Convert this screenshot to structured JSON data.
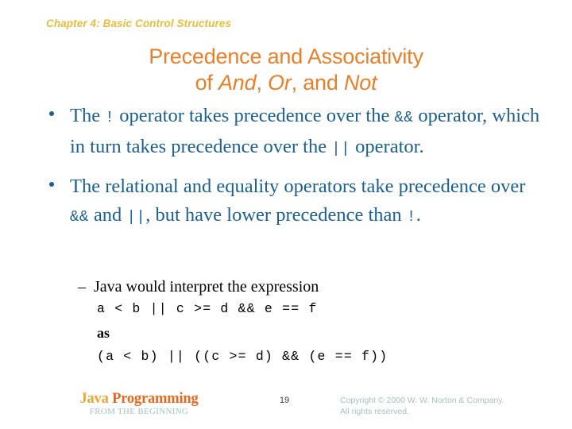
{
  "slide": {
    "background_color": "#ffffff",
    "chapter_header": "Chapter 4: Basic Control Structures",
    "chapter_header_color": "#e8bc3c",
    "title": {
      "color": "#e8802a",
      "line1": "Precedence and Associativity",
      "line2_prefix": "of ",
      "line2_em1": "And",
      "line2_mid1": ", ",
      "line2_em2": "Or",
      "line2_mid2": ", and ",
      "line2_em3": "Not"
    },
    "body_color": "#1c6090",
    "bullets": [
      {
        "marker": "bullet-dot",
        "segments": [
          {
            "kind": "text",
            "value": "The "
          },
          {
            "kind": "code",
            "value": "!"
          },
          {
            "kind": "text",
            "value": " operator takes precedence over the "
          },
          {
            "kind": "code",
            "value": "&&"
          },
          {
            "kind": "text",
            "value": " operator, which in turn takes precedence over the "
          },
          {
            "kind": "code",
            "value": "||"
          },
          {
            "kind": "text",
            "value": " operator."
          }
        ],
        "plain": "The ! operator takes precedence over the && operator, which in turn takes precedence over the || operator."
      },
      {
        "marker": "bullet-dot",
        "segments": [
          {
            "kind": "text",
            "value": "The relational and equality operators take precedence over "
          },
          {
            "kind": "code",
            "value": "&&"
          },
          {
            "kind": "text",
            "value": " and "
          },
          {
            "kind": "code",
            "value": "||"
          },
          {
            "kind": "text",
            "value": ", but have lower precedence than "
          },
          {
            "kind": "code",
            "value": "!"
          },
          {
            "kind": "text",
            "value": "."
          }
        ],
        "plain": "The relational and equality operators take precedence over && and ||, but have lower precedence than !."
      }
    ],
    "subbullet": {
      "dash": "–",
      "intro": "Java would interpret the expression",
      "code_before": "a < b || c >= d && e == f",
      "as_label": "as",
      "code_after": "(a < b) || ((c >= d) && (e == f))"
    },
    "footer": {
      "logo_word1": "Java",
      "logo_space": " ",
      "logo_word2": "Programming",
      "logo_subtitle": "FROM THE BEGINNING",
      "logo_color_1": "#f0a52e",
      "logo_color_2": "#e8671c",
      "page_number": "19",
      "copyright_line1": "Copyright © 2000 W. W. Norton & Company.",
      "copyright_line2": "All rights reserved.",
      "copyright_color": "#a8bfc0"
    }
  }
}
